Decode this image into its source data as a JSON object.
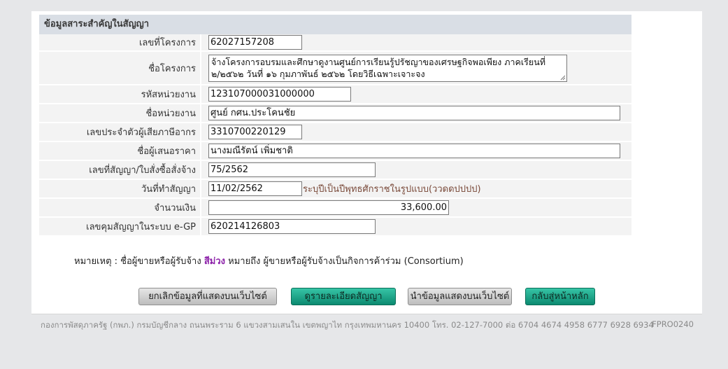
{
  "section": {
    "title": "ข้อมูลสาระสำคัญในสัญญา"
  },
  "fields": {
    "project_no": {
      "label": "เลขที่โครงการ",
      "value": "62027157208"
    },
    "project_name": {
      "label": "ชื่อโครงการ",
      "line1": "จ้างโครงการอบรมและศึกษาดูงานศูนย์การเรียนรู้ปรัชญาของเศรษฐกิจพอเพียง ภาคเรียนที่",
      "line2": "๒/๒๕๖๒ วันที่ ๑๖ กุมภาพันธ์ ๒๕๖๒ โดยวิธีเฉพาะเจาะจง"
    },
    "agency_code": {
      "label": "รหัสหน่วยงาน",
      "value": "123107000031000000"
    },
    "agency_name": {
      "label": "ชื่อหน่วยงาน",
      "value": "ศูนย์ กศน.ประโคนชัย"
    },
    "taxpayer_id": {
      "label": "เลขประจำตัวผู้เสียภาษีอากร",
      "value": "3310700220129"
    },
    "bidder_name": {
      "label": "ชื่อผู้เสนอราคา",
      "value": "นางมณีรัตน์ เพิ่มชาติ"
    },
    "contract_no": {
      "label": "เลขที่สัญญา/ใบสั่งซื้อสั่งจ้าง",
      "value": "75/2562"
    },
    "contract_date": {
      "label": "วันที่ทำสัญญา",
      "value": "11/02/2562",
      "hint": "ระบุปีเป็นปีพุทธศักราชในรูปแบบ(ววดดปปปป)"
    },
    "amount": {
      "label": "จำนวนเงิน",
      "value": "33,600.00"
    },
    "egp_control": {
      "label": "เลขคุมสัญญาในระบบ e-GP",
      "value": "620214126803"
    }
  },
  "note": {
    "prefix": "หมายเหตุ : ชื่อผู้ขายหรือผู้รับจ้าง",
    "highlight": "สีม่วง",
    "suffix": "หมายถึง ผู้ขายหรือผู้รับจ้างเป็นกิจการค้าร่วม (Consortium)"
  },
  "buttons": {
    "cancel_display": "ยกเลิกข้อมูลที่แสดงบนเว็บไซต์",
    "view_details": "ดูรายละเอียดสัญญา",
    "display_on_web": "นำข้อมูลแสดงบนเว็บไซต์",
    "back_home": "กลับสู่หน้าหลัก"
  },
  "footer": {
    "text": "กองการพัสดุภาครัฐ (กพภ.) กรมบัญชีกลาง ถนนพระราม 6 แขวงสามเสนใน เขตพญาไท กรุงเทพมหานคร 10400 โทร. 02-127-7000 ต่อ 6704 4674 4958 6777 6928 6934",
    "code": "FPRO0240"
  },
  "colors": {
    "header_bg": "#d9dee5",
    "row_bg": "#f3f3f3",
    "consortium": "#8b1fa8",
    "button_green": "#0c8a70"
  }
}
